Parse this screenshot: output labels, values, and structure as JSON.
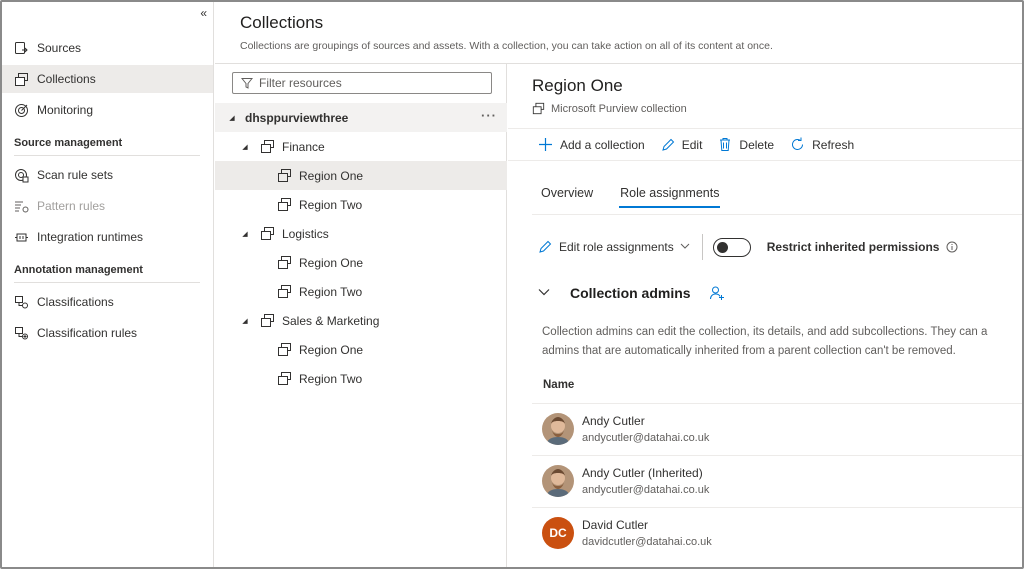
{
  "nav": {
    "collapse_glyph": "«",
    "items": [
      {
        "label": "Sources",
        "icon": "sources-icon"
      },
      {
        "label": "Collections",
        "icon": "collections-icon"
      },
      {
        "label": "Monitoring",
        "icon": "monitoring-icon"
      }
    ],
    "section_source": "Source management",
    "source_items": [
      {
        "label": "Scan rule sets",
        "icon": "scan-rule-sets-icon"
      },
      {
        "label": "Pattern rules",
        "icon": "pattern-rules-icon"
      },
      {
        "label": "Integration runtimes",
        "icon": "integration-runtimes-icon"
      }
    ],
    "section_annotation": "Annotation management",
    "annotation_items": [
      {
        "label": "Classifications",
        "icon": "classifications-icon"
      },
      {
        "label": "Classification rules",
        "icon": "classification-rules-icon"
      }
    ]
  },
  "header": {
    "title": "Collections",
    "subtitle": "Collections are groupings of sources and assets. With a collection, you can take action on all of its content at once."
  },
  "tree": {
    "filter_placeholder": "Filter resources",
    "root": "dhsppurviewthree",
    "more_glyph": "···",
    "groups": [
      {
        "label": "Finance",
        "children": [
          "Region One",
          "Region Two"
        ]
      },
      {
        "label": "Logistics",
        "children": [
          "Region One",
          "Region Two"
        ]
      },
      {
        "label": "Sales & Marketing",
        "children": [
          "Region One",
          "Region Two"
        ]
      }
    ]
  },
  "detail": {
    "title": "Region One",
    "subtitle": "Microsoft Purview collection",
    "toolbar": {
      "add": "Add a collection",
      "edit": "Edit",
      "delete": "Delete",
      "refresh": "Refresh"
    },
    "tabs": [
      "Overview",
      "Role assignments"
    ],
    "edit_roles": "Edit role assignments",
    "restrict": "Restrict inherited permissions",
    "section_title": "Collection admins",
    "section_desc_line1": "Collection admins can edit the collection, its details, and add subcollections. They can a",
    "section_desc_line2": "admins that are automatically inherited from a parent collection can't be removed.",
    "column_name": "Name",
    "users": [
      {
        "name": "Andy Cutler",
        "email": "andycutler@datahai.co.uk",
        "avatar": "photo"
      },
      {
        "name": "Andy Cutler (Inherited)",
        "email": "andycutler@datahai.co.uk",
        "avatar": "photo"
      },
      {
        "name": "David Cutler",
        "email": "davidcutler@datahai.co.uk",
        "avatar": "DC"
      }
    ]
  },
  "colors": {
    "accent": "#0078d4",
    "selected_bg": "#edebe9",
    "avatar_dc": "#ca5010"
  }
}
